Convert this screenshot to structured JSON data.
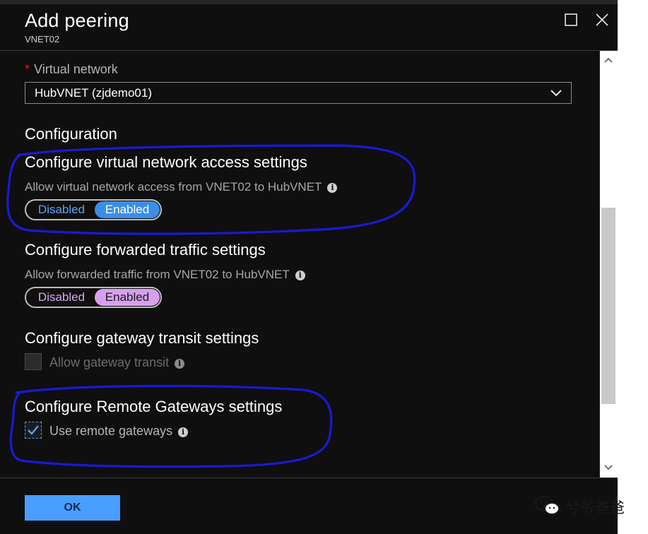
{
  "header": {
    "title": "Add peering",
    "subtitle": "VNET02"
  },
  "virtual_network": {
    "required_mark": "*",
    "label": "Virtual network",
    "selected": "HubVNET (zjdemo01)"
  },
  "configuration": {
    "heading": "Configuration",
    "access": {
      "heading": "Configure virtual network access settings",
      "description": "Allow virtual network access from VNET02 to HubVNET",
      "options": [
        "Disabled",
        "Enabled"
      ],
      "selected": "Enabled"
    },
    "forwarded": {
      "heading": "Configure forwarded traffic settings",
      "description": "Allow forwarded traffic from VNET02 to HubVNET",
      "options": [
        "Disabled",
        "Enabled"
      ],
      "selected": "Enabled"
    },
    "gateway_transit": {
      "heading": "Configure gateway transit settings",
      "checkbox_label": "Allow gateway transit",
      "checked": false
    },
    "remote_gateways": {
      "heading": "Configure Remote Gateways settings",
      "checkbox_label": "Use remote gateways",
      "checked": true
    }
  },
  "footer": {
    "ok_label": "OK"
  },
  "watermark": {
    "text": "兮爷爸爸"
  },
  "colors": {
    "blade_bg": "#0f0f0f",
    "toggle_access_active": "#3a8ee6",
    "toggle_forward_active": "#d7a0ee",
    "ok_button": "#4a9eff",
    "annotation_stroke": "#1a1ad6"
  },
  "icons": {
    "maximize": "maximize-icon",
    "close": "close-icon",
    "dropdown": "chevron-down-icon",
    "info": "info-icon",
    "check": "check-icon"
  }
}
